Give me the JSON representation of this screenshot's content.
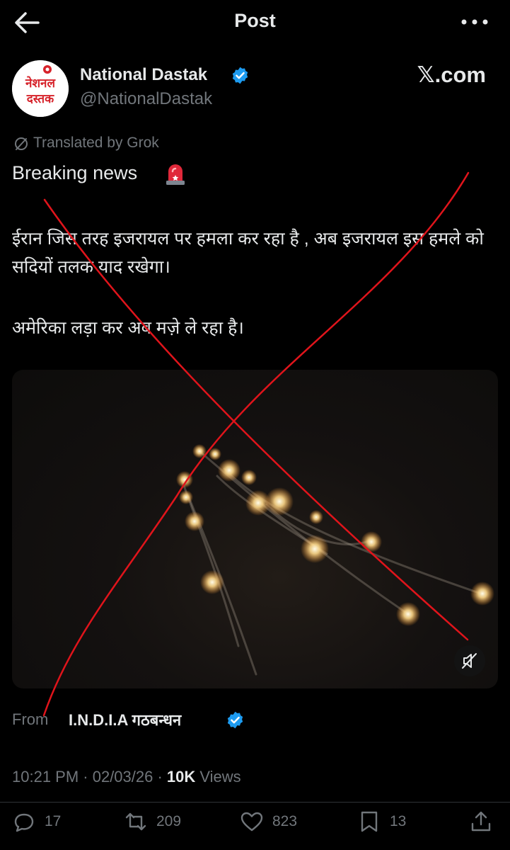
{
  "header": {
    "title": "Post"
  },
  "author": {
    "name": "National Dastak",
    "handle": "@NationalDastak",
    "avatar_text_top": "नेशनल",
    "avatar_text_bottom": "दस्तक"
  },
  "watermark": "𝕏.com",
  "post": {
    "translated_label": "Translated by Grok",
    "headline": "Breaking news",
    "paragraph1": "ईरान जिस तरह इजरायल पर हमला कर रहा है , अब इजरायल इस हमले को सदियों तलक याद रखेगा।",
    "paragraph2": "अमेरिका लड़ा कर अब मज़े ले रहा है।"
  },
  "source": {
    "from_label": "From",
    "name": "I.N.D.I.A गठबन्धन"
  },
  "meta": {
    "time": "10:21 PM · 02/03/26 · ",
    "views_count": "10K",
    "views_label": " Views"
  },
  "actions": {
    "replies": "17",
    "reposts": "209",
    "likes": "823",
    "bookmarks": "13"
  },
  "colors": {
    "background": "#000000",
    "text": "#e7e9ea",
    "muted": "#71767b",
    "verified": "#1d9bf0",
    "cross": "#e0141b"
  }
}
